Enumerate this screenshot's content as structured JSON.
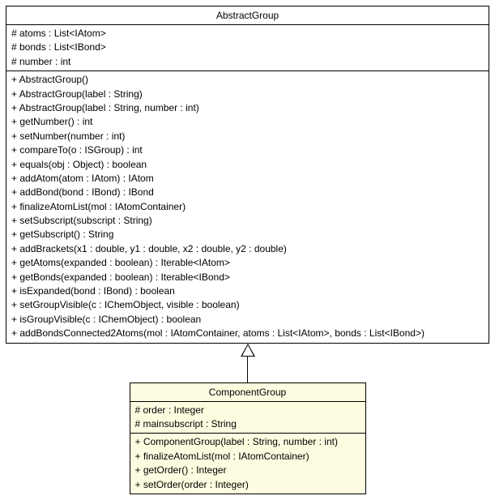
{
  "chart_data": {
    "type": "uml-class-diagram",
    "classes": [
      {
        "name": "AbstractGroup",
        "attributes": [
          "# atoms : List<IAtom>",
          "# bonds : List<IBond>",
          "# number : int"
        ],
        "operations": [
          "+ AbstractGroup()",
          "+ AbstractGroup(label : String)",
          "+ AbstractGroup(label : String, number : int)",
          "+ getNumber() : int",
          "+ setNumber(number : int)",
          "+ compareTo(o : ISGroup) : int",
          "+ equals(obj : Object) : boolean",
          "+ addAtom(atom : IAtom) : IAtom",
          "+ addBond(bond : IBond) : IBond",
          "+ finalizeAtomList(mol : IAtomContainer)",
          "+ setSubscript(subscript : String)",
          "+ getSubscript() : String",
          "+ addBrackets(x1 : double, y1 : double, x2 : double, y2 : double)",
          "+ getAtoms(expanded : boolean) : Iterable<IAtom>",
          "+ getBonds(expanded : boolean) : Iterable<IBond>",
          "+ isExpanded(bond : IBond) : boolean",
          "+ setGroupVisible(c : IChemObject, visible : boolean)",
          "+ isGroupVisible(c : IChemObject) : boolean",
          "+ addBondsConnected2Atoms(mol : IAtomContainer, atoms : List<IAtom>, bonds : List<IBond>)"
        ]
      },
      {
        "name": "ComponentGroup",
        "extends": "AbstractGroup",
        "attributes": [
          "# order : Integer",
          "# mainsubscript : String"
        ],
        "operations": [
          "+ ComponentGroup(label : String, number : int)",
          "+ finalizeAtomList(mol : IAtomContainer)",
          "+ getOrder() : Integer",
          "+ setOrder(order : Integer)"
        ]
      }
    ],
    "relations": [
      {
        "from": "ComponentGroup",
        "to": "AbstractGroup",
        "type": "generalization"
      }
    ]
  }
}
